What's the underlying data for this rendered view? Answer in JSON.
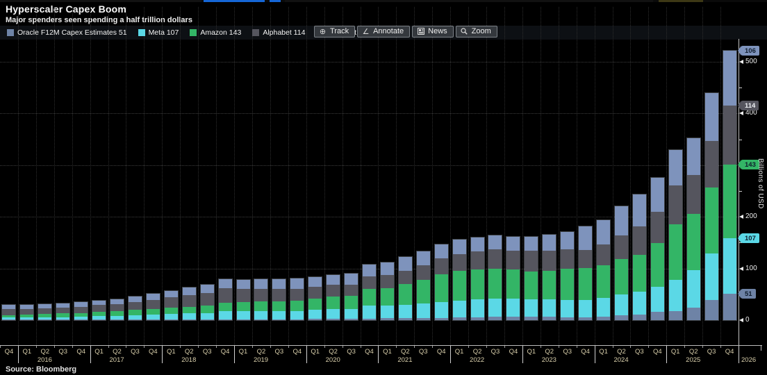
{
  "header": {
    "title": "Hyperscaler Capex Boom",
    "subtitle": "Major spenders seen spending a half trillion dollars"
  },
  "toolbar": {
    "buttons": [
      {
        "name": "track",
        "icon": "track-icon",
        "label": "Track"
      },
      {
        "name": "annotate",
        "icon": "annotate-icon",
        "label": "Annotate"
      },
      {
        "name": "news",
        "icon": "news-icon",
        "label": "News"
      },
      {
        "name": "zoom",
        "icon": "zoom-icon",
        "label": "Zoom"
      }
    ]
  },
  "source": "Source: Bloomberg",
  "chart_data": {
    "type": "bar",
    "stacked": true,
    "title": "Hyperscaler Capex Boom",
    "ylabel": "Billions of USD",
    "ylim": [
      0,
      540
    ],
    "y_ticks": [
      0,
      100,
      200,
      300,
      400,
      500
    ],
    "y_minor_ticks": [
      50,
      150,
      250,
      350,
      450
    ],
    "grid": "dotted",
    "legend_position": "top-left",
    "x_quarter_labels": [
      "Q4",
      "Q1",
      "Q2",
      "Q3",
      "Q4",
      "Q1",
      "Q2",
      "Q3",
      "Q4",
      "Q1",
      "Q2",
      "Q3",
      "Q4",
      "Q1",
      "Q2",
      "Q3",
      "Q4",
      "Q1",
      "Q2",
      "Q3",
      "Q4",
      "Q1",
      "Q2",
      "Q3",
      "Q4",
      "Q1",
      "Q2",
      "Q3",
      "Q4",
      "Q1",
      "Q2",
      "Q3",
      "Q4",
      "Q1",
      "Q2",
      "Q3",
      "Q4",
      "Q1",
      "Q2",
      "Q3",
      "Q4"
    ],
    "x_year_labels": [
      {
        "year": "2016",
        "bar_index": 2
      },
      {
        "year": "2017",
        "bar_index": 6
      },
      {
        "year": "2018",
        "bar_index": 10
      },
      {
        "year": "2019",
        "bar_index": 14
      },
      {
        "year": "2020",
        "bar_index": 18
      },
      {
        "year": "2021",
        "bar_index": 22
      },
      {
        "year": "2022",
        "bar_index": 26
      },
      {
        "year": "2023",
        "bar_index": 30
      },
      {
        "year": "2024",
        "bar_index": 34
      },
      {
        "year": "2025",
        "bar_index": 38
      },
      {
        "year": "2026",
        "position": "axis-end"
      }
    ],
    "series": [
      {
        "name": "Oracle F12M Capex Estimates",
        "legend_value": "51",
        "color": "#6e83a6",
        "values": [
          1,
          1,
          1,
          1,
          1,
          1,
          1,
          2,
          2,
          2,
          2,
          2,
          2,
          2,
          2,
          2,
          2,
          3,
          3,
          3,
          3,
          4,
          4,
          4,
          4,
          5,
          6,
          7,
          7,
          7,
          7,
          6,
          6,
          7,
          10,
          11,
          16,
          18,
          24,
          39,
          51
        ]
      },
      {
        "name": "Meta",
        "legend_value": "107",
        "color": "#5bd8e6",
        "values": [
          4,
          4,
          5,
          5,
          6,
          7,
          7,
          8,
          9,
          10,
          11,
          12,
          15,
          15,
          16,
          16,
          16,
          17,
          18,
          19,
          25,
          24,
          26,
          28,
          31,
          33,
          34,
          35,
          34,
          34,
          33,
          33,
          33,
          36,
          40,
          44,
          48,
          60,
          73,
          90,
          107
        ]
      },
      {
        "name": "Amazon",
        "legend_value": "143",
        "color": "#33b566",
        "values": [
          5,
          6,
          6,
          7,
          7,
          8,
          9,
          10,
          11,
          12,
          13,
          14,
          17,
          18,
          18,
          19,
          20,
          22,
          25,
          25,
          33,
          34,
          40,
          46,
          54,
          57,
          58,
          58,
          57,
          53,
          55,
          60,
          62,
          63,
          68,
          72,
          85,
          107,
          108,
          128,
          143
        ]
      },
      {
        "name": "Alphabet",
        "legend_value": "114",
        "color": "#55555e",
        "values": [
          12,
          11,
          11,
          11,
          12,
          13,
          14,
          15,
          17,
          20,
          23,
          25,
          28,
          25,
          24,
          23,
          22,
          22,
          22,
          22,
          24,
          25,
          26,
          28,
          31,
          33,
          35,
          37,
          36,
          40,
          40,
          38,
          35,
          40,
          46,
          54,
          61,
          76,
          76,
          90,
          114
        ]
      },
      {
        "name": "Microsoft",
        "legend_value": "106",
        "color": "#7e93bc",
        "values": [
          7,
          8,
          8,
          8,
          9,
          9,
          10,
          11,
          12,
          13,
          14,
          15,
          17,
          18,
          19,
          20,
          21,
          20,
          20,
          21,
          23,
          24,
          26,
          27,
          27,
          28,
          27,
          27,
          27,
          28,
          30,
          34,
          45,
          48,
          57,
          63,
          66,
          69,
          71,
          92,
          106
        ]
      }
    ],
    "end_badges": [
      {
        "text": "51",
        "at_value": 51,
        "color": "#6e83a6",
        "text_color": "#0e1c2c"
      },
      {
        "text": "107",
        "at_value": 158,
        "color": "#5bd8e6",
        "text_color": "#0e1c2c"
      },
      {
        "text": "143",
        "at_value": 301,
        "color": "#33b566",
        "text_color": "#0e1c2c"
      },
      {
        "text": "114",
        "at_value": 415,
        "color": "#55555e",
        "text_color": "#eef1f4"
      },
      {
        "text": "106",
        "at_value": 521,
        "color": "#7e93bc",
        "text_color": "#0e1c2c"
      }
    ]
  }
}
